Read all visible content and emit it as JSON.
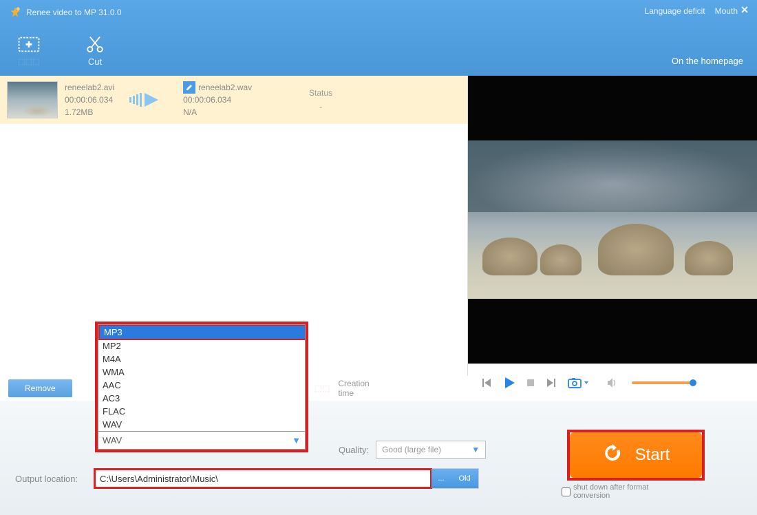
{
  "header": {
    "app_title": "Renee video to MP 31.0.0",
    "language_link": "Language deficit",
    "mouth_label": "Mouth",
    "homepage_link": "On the homepage"
  },
  "toolbar": {
    "add_label": "",
    "cut_label": "Cut"
  },
  "file": {
    "source_name": "reneelab2.avi",
    "source_duration": "00:00:06.034",
    "source_size": "1.72MB",
    "target_name": "reneelab2.wav",
    "target_duration": "00:00:06.034",
    "target_size": "N/A",
    "status_header": "Status",
    "status_value": "-"
  },
  "format_dropdown": {
    "options": [
      "MP3",
      "MP2",
      "M4A",
      "WMA",
      "AAC",
      "AC3",
      "FLAC",
      "WAV"
    ],
    "selected": "MP3",
    "current": "WAV"
  },
  "midbar": {
    "remove": "Remove",
    "creation_time": "Creation time"
  },
  "quality": {
    "label": "Quality:",
    "value": "Good (large file)"
  },
  "output": {
    "label": "Output location:",
    "path": "C:\\Users\\Administrator\\Music\\",
    "browse": "...",
    "old": "Old"
  },
  "start": {
    "label": "Start"
  },
  "shutdown": {
    "label": "shut down after format conversion"
  }
}
